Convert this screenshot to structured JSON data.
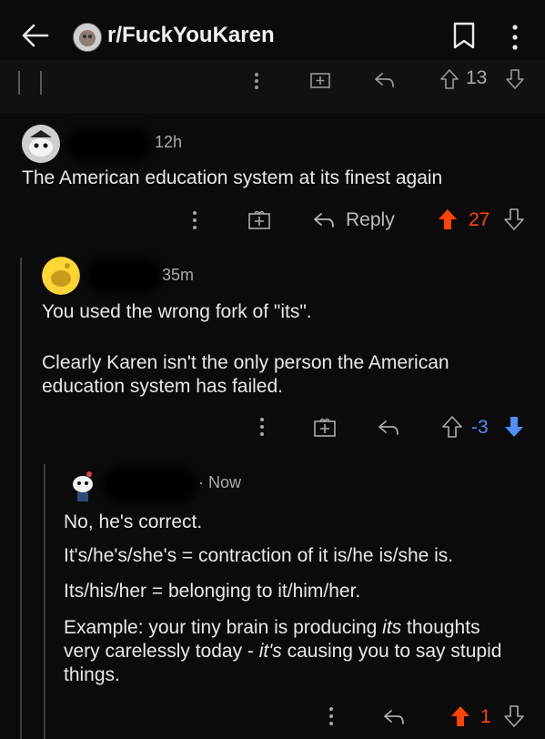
{
  "header": {
    "subreddit": "r/FuckYouKaren"
  },
  "top_bar_actions": {
    "vote_count": "13"
  },
  "comments": [
    {
      "age": "12h",
      "body": "The American education system at its finest again",
      "reply_label": "Reply",
      "vote_count": "27",
      "vote_color": "#ff4500"
    },
    {
      "age": "35m",
      "body_line1": "You used the wrong fork of \"its\".",
      "body_para2_line1": "Clearly Karen isn't the only person the American",
      "body_para2_line2": "education system has failed.",
      "vote_count": "-3",
      "vote_color": "#4f8ff7"
    },
    {
      "age": "Now",
      "p1": "No, he's correct.",
      "p2": "It's/he's/she's = contraction of it is/he is/she is.",
      "p3": "Its/his/her = belonging to it/him/her.",
      "p4_a": "Example: your tiny brain is producing ",
      "p4_b": "its",
      "p4_c": " thoughts",
      "p4_line2_a": "very carelessly today - ",
      "p4_line2_b": "it's",
      "p4_line2_c": " causing you to say stupid",
      "p4_line3": "things.",
      "vote_count": "1",
      "vote_color": "#ff4500"
    }
  ],
  "colors": {
    "background": "#0b0b0b",
    "upvote": "#ff4500",
    "downvote": "#4f8ff7"
  }
}
